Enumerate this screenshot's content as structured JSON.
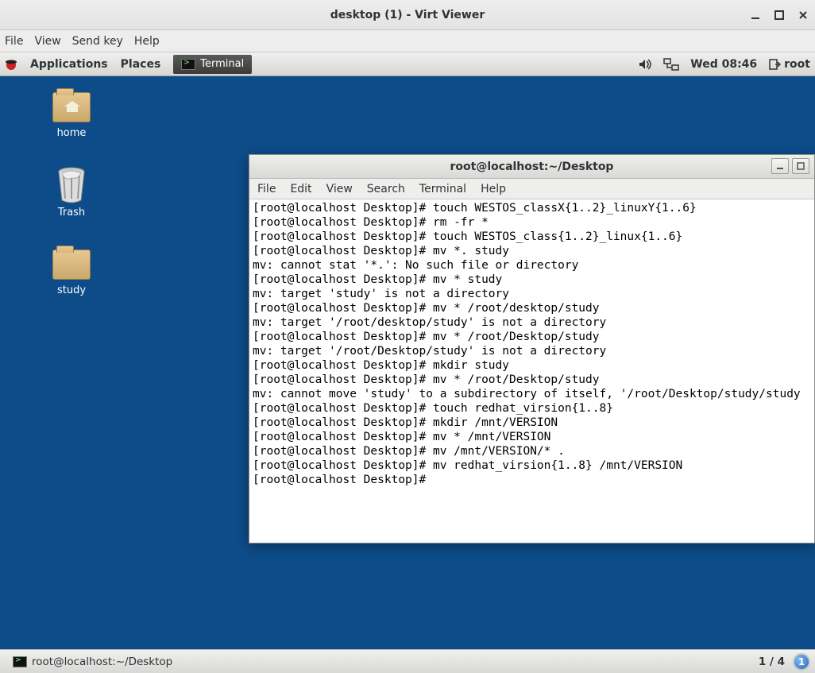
{
  "virt_viewer": {
    "title": "desktop (1) - Virt Viewer",
    "menu": {
      "file": "File",
      "view": "View",
      "send_key": "Send key",
      "help": "Help"
    }
  },
  "gnome": {
    "top": {
      "applications": "Applications",
      "places": "Places",
      "task_terminal": "Terminal",
      "clock": "Wed 08:46",
      "user": "root"
    },
    "desktop_icons": {
      "home": "home",
      "trash": "Trash",
      "study": "study"
    },
    "bottom": {
      "task": "root@localhost:~/Desktop",
      "workspace": "1 / 4",
      "badge": "1"
    }
  },
  "terminal": {
    "title": "root@localhost:~/Desktop",
    "menu": {
      "file": "File",
      "edit": "Edit",
      "view": "View",
      "search": "Search",
      "terminal": "Terminal",
      "help": "Help"
    },
    "lines": [
      "[root@localhost Desktop]# touch WESTOS_classX{1..2}_linuxY{1..6}",
      "[root@localhost Desktop]# rm -fr *",
      "[root@localhost Desktop]# touch WESTOS_class{1..2}_linux{1..6}",
      "[root@localhost Desktop]# mv *. study",
      "mv: cannot stat '*.': No such file or directory",
      "[root@localhost Desktop]# mv * study",
      "mv: target 'study' is not a directory",
      "[root@localhost Desktop]# mv * /root/desktop/study",
      "mv: target '/root/desktop/study' is not a directory",
      "[root@localhost Desktop]# mv * /root/Desktop/study",
      "mv: target '/root/Desktop/study' is not a directory",
      "[root@localhost Desktop]# mkdir study",
      "[root@localhost Desktop]# mv * /root/Desktop/study",
      "mv: cannot move 'study' to a subdirectory of itself, '/root/Desktop/study/study",
      "[root@localhost Desktop]# touch redhat_virsion{1..8}",
      "[root@localhost Desktop]# mkdir /mnt/VERSION",
      "[root@localhost Desktop]# mv * /mnt/VERSION",
      "[root@localhost Desktop]# mv /mnt/VERSION/* .",
      "[root@localhost Desktop]# mv redhat_virsion{1..8} /mnt/VERSION",
      "[root@localhost Desktop]# "
    ]
  }
}
